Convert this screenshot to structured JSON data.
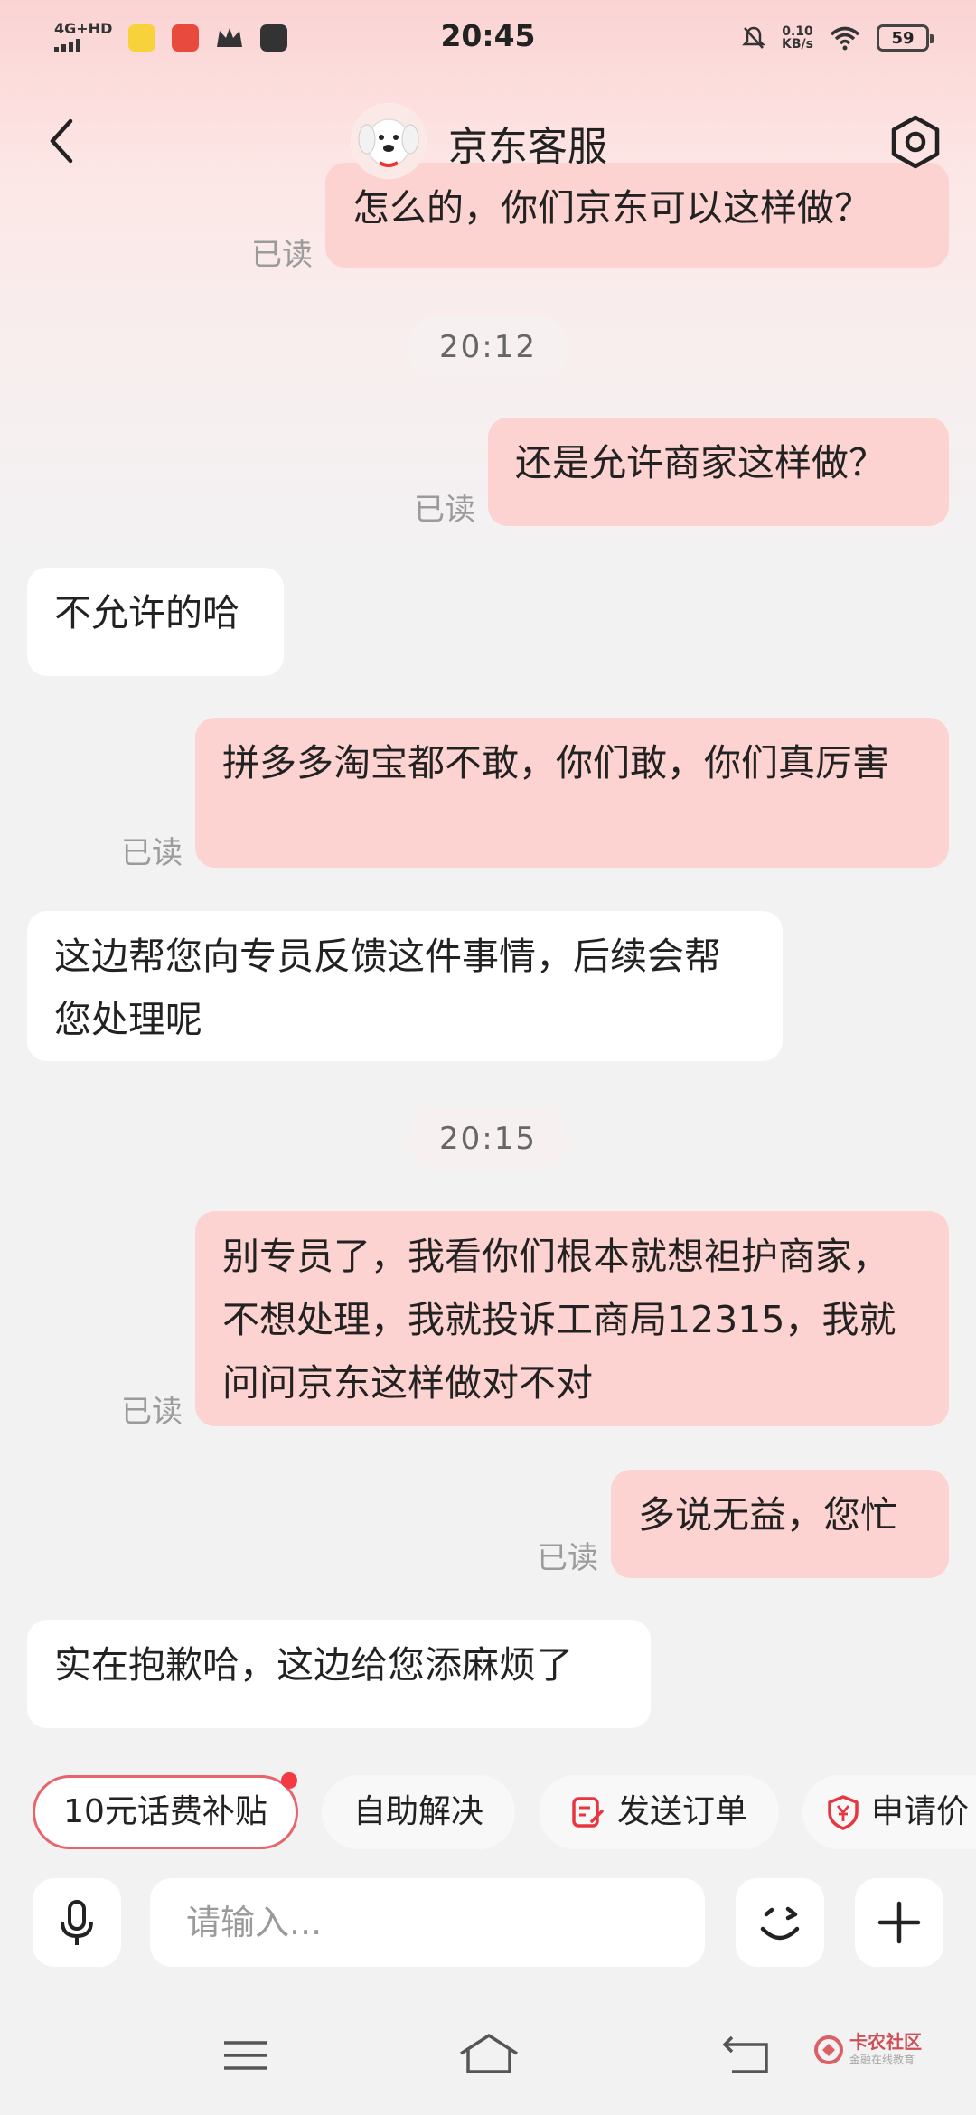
{
  "status_bar": {
    "network": "4G+HD",
    "time": "20:45",
    "speed_value": "0.10",
    "speed_unit": "KB/s",
    "battery": "59"
  },
  "header": {
    "title": "京东客服"
  },
  "messages": [
    {
      "side": "sent",
      "text": "怎么的，你们京东可以这样做？",
      "read": "已读"
    },
    {
      "type": "time",
      "text": "20:12"
    },
    {
      "side": "sent",
      "text": "还是允许商家这样做？",
      "read": "已读"
    },
    {
      "side": "recv",
      "text": "不允许的哈"
    },
    {
      "side": "sent",
      "text": "拼多多淘宝都不敢，你们敢，你们真厉害",
      "read": "已读"
    },
    {
      "side": "recv",
      "text": "这边帮您向专员反馈这件事情，后续会帮您处理呢"
    },
    {
      "type": "time",
      "text": "20:15"
    },
    {
      "side": "sent",
      "text": "别专员了，我看你们根本就想袒护商家，不想处理，我就投诉工商局12315，我就问问京东这样做对不对",
      "read": "已读"
    },
    {
      "side": "sent",
      "text": "多说无益，您忙",
      "read": "已读"
    },
    {
      "side": "recv",
      "text": "实在抱歉哈，这边给您添麻烦了"
    }
  ],
  "quick_actions": [
    "10元话费补贴",
    "自助解决",
    "发送订单",
    "申请价"
  ],
  "input": {
    "placeholder": "请输入..."
  },
  "watermark": {
    "title": "卡农社区",
    "subtitle": "金融在线教育"
  },
  "colors": {
    "sent_bubble": "#fdd3d1",
    "recv_bubble": "#ffffff",
    "accent": "#e8636a",
    "background": "#f2f2f3"
  },
  "icons": [
    "back-arrow-icon",
    "jd-dog-avatar-icon",
    "settings-hexagon-icon",
    "microphone-icon",
    "emoji-wink-icon",
    "plus-icon",
    "order-edit-icon",
    "price-protect-icon",
    "menu-lines-icon",
    "home-icon",
    "back-return-icon"
  ]
}
